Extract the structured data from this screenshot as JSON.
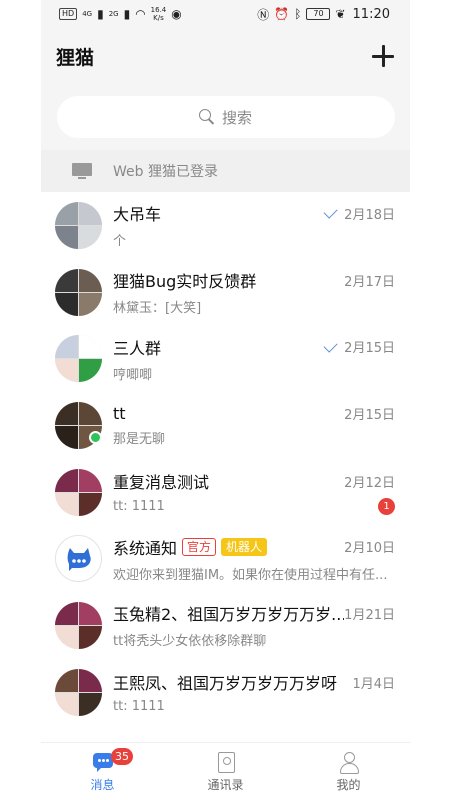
{
  "status_bar": {
    "left_chip": "HD",
    "signal_1": "4G",
    "signal_2": "2G",
    "speed": "16.4",
    "speed_unit": "K/s",
    "battery": "70",
    "time": "11:20"
  },
  "header": {
    "title": "狸猫"
  },
  "search": {
    "placeholder": "搜索"
  },
  "web_bar": {
    "text": "Web 狸猫已登录"
  },
  "conversations": [
    {
      "name": "大吊车",
      "preview": "个",
      "date": "2月18日",
      "sent_check": true,
      "avatar_colors": [
        "#9aa0a8",
        "#c5c9cf",
        "#7d838c",
        "#d9dcdf"
      ]
    },
    {
      "name": "狸猫Bug实时反馈群",
      "preview": "林黛玉：[大笑]",
      "date": "2月17日",
      "sent_check": false,
      "avatar_colors": [
        "#3a3a3a",
        "#6b5d52",
        "#2c2c2c",
        "#8a7a6a"
      ]
    },
    {
      "name": "三人群",
      "preview": "哼唧唧",
      "date": "2月15日",
      "sent_check": true,
      "avatar_colors": [
        "#c8d0e0",
        "#ffffff",
        "#f2ddd5",
        "#2f9e44"
      ]
    },
    {
      "name": "tt",
      "preview": "那是无聊",
      "date": "2月15日",
      "sent_check": false,
      "online": true,
      "avatar_colors": [
        "#3b2f25",
        "#5c4636",
        "#2a211a",
        "#6e5642"
      ]
    },
    {
      "name": "重复消息测试",
      "preview": "tt:  1111",
      "date": "2月12日",
      "sent_check": false,
      "unread": "1",
      "avatar_colors": [
        "#7a2a4a",
        "#a33e63",
        "#f2ddd5",
        "#5c2e2a"
      ]
    },
    {
      "name": "系统通知",
      "preview": "欢迎你来到狸猫IM。如果你在使用过程中有任...",
      "date": "2月10日",
      "sent_check": false,
      "tags": [
        "官方",
        "机器人"
      ],
      "avatar_colors": [
        "#ffffff",
        "#ffffff",
        "#ffffff",
        "#ffffff"
      ]
    },
    {
      "name": "玉兔精2、祖国万岁万岁万万岁...",
      "preview": "tt将秃头少女依依移除群聊",
      "date": "1月21日",
      "sent_check": false,
      "avatar_colors": [
        "#7a2a4a",
        "#a33e63",
        "#f2ddd5",
        "#5c2e2a"
      ]
    },
    {
      "name": "王熙凤、祖国万岁万岁万万岁呀",
      "preview": "tt:  1111",
      "date": "1月4日",
      "sent_check": false,
      "avatar_colors": [
        "#6b4a3a",
        "#7a2a4a",
        "#f2ddd5",
        "#3b2f25"
      ]
    }
  ],
  "bottom_nav": [
    {
      "label": "消息",
      "icon": "message-icon",
      "active": true,
      "badge": "35"
    },
    {
      "label": "通讯录",
      "icon": "contacts-icon",
      "active": false
    },
    {
      "label": "我的",
      "icon": "profile-icon",
      "active": false
    }
  ],
  "colors": {
    "accent": "#3b7de8",
    "badge_red": "#e8413c",
    "online_green": "#2ec25a",
    "robot_tag": "#f5c518"
  }
}
